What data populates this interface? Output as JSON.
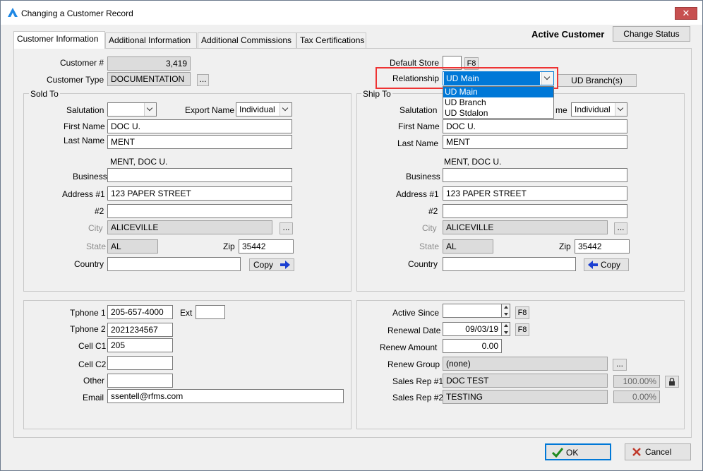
{
  "window": {
    "title": "Changing a Customer Record",
    "close": "✕"
  },
  "tabs": [
    {
      "label": "Customer Information"
    },
    {
      "label": "Additional Information"
    },
    {
      "label": "Additional Commissions"
    },
    {
      "label": "Tax Certifications"
    }
  ],
  "header": {
    "status_label": "Active Customer",
    "change_status": "Change Status"
  },
  "top": {
    "customer_no_label": "Customer #",
    "customer_no": "3,419",
    "customer_type_label": "Customer Type",
    "customer_type": "DOCUMENTATION",
    "ellipsis": "...",
    "default_store_label": "Default Store",
    "default_store": "",
    "f8": "F8",
    "relationship_label": "Relationship",
    "relationship_value": "UD Main",
    "relationship_options": [
      "UD Main",
      "UD Branch",
      "UD Stdalon"
    ],
    "ud_branches_btn": "UD Branch(s)"
  },
  "sold_to": {
    "title": "Sold To",
    "salutation_label": "Salutation",
    "salutation": "",
    "export_name_label": "Export Name",
    "export_name": "Individual",
    "first_name_label": "First Name",
    "first_name": "DOC U.",
    "last_name_label": "Last Name",
    "last_name": "MENT",
    "full_name": "MENT, DOC U.",
    "business_label": "Business",
    "business": "",
    "address1_label": "Address #1",
    "address1": "123 PAPER STREET",
    "address2_label": "#2",
    "address2": "",
    "city_label": "City",
    "city": "ALICEVILLE",
    "state_label": "State",
    "state": "AL",
    "zip_label": "Zip",
    "zip": "35442",
    "country_label": "Country",
    "country": "",
    "copy_btn": "Copy"
  },
  "ship_to": {
    "title": "Ship To",
    "salutation_label": "Salutation",
    "export_name_label": "me",
    "export_name": "Individual",
    "first_name_label": "First Name",
    "first_name": "DOC U.",
    "last_name_label": "Last Name",
    "last_name": "MENT",
    "full_name": "MENT, DOC U.",
    "business_label": "Business",
    "business": "",
    "address1_label": "Address #1",
    "address1": "123 PAPER STREET",
    "address2_label": "#2",
    "address2": "",
    "city_label": "City",
    "city": "ALICEVILLE",
    "state_label": "State",
    "state": "AL",
    "zip_label": "Zip",
    "zip": "35442",
    "country_label": "Country",
    "country": "",
    "copy_btn": "Copy"
  },
  "contact": {
    "phone1_label": "Tphone 1",
    "phone1": "205-657-4000",
    "ext_label": "Ext",
    "ext": "",
    "phone2_label": "Tphone 2",
    "phone2": "2021234567",
    "cell1_label": "Cell C1",
    "cell1": "205",
    "cell2_label": "Cell C2",
    "cell2": "",
    "other_label": "Other",
    "other": "",
    "email_label": "Email",
    "email": "ssentell@rfms.com"
  },
  "account": {
    "active_since_label": "Active Since",
    "active_since": "",
    "renewal_date_label": "Renewal Date",
    "renewal_date": "09/03/19",
    "renew_amount_label": "Renew Amount",
    "renew_amount": "0.00",
    "renew_group_label": "Renew Group",
    "renew_group": "(none)",
    "sales_rep1_label": "Sales Rep #1",
    "sales_rep1": "DOC TEST",
    "sales_rep1_pct": "100.00%",
    "sales_rep2_label": "Sales Rep #2",
    "sales_rep2": "TESTING",
    "sales_rep2_pct": "0.00%"
  },
  "footer": {
    "ok": "OK",
    "cancel": "Cancel"
  },
  "colors": {
    "accent": "#0078d7",
    "highlight": "#e33333",
    "close": "#c75050"
  }
}
